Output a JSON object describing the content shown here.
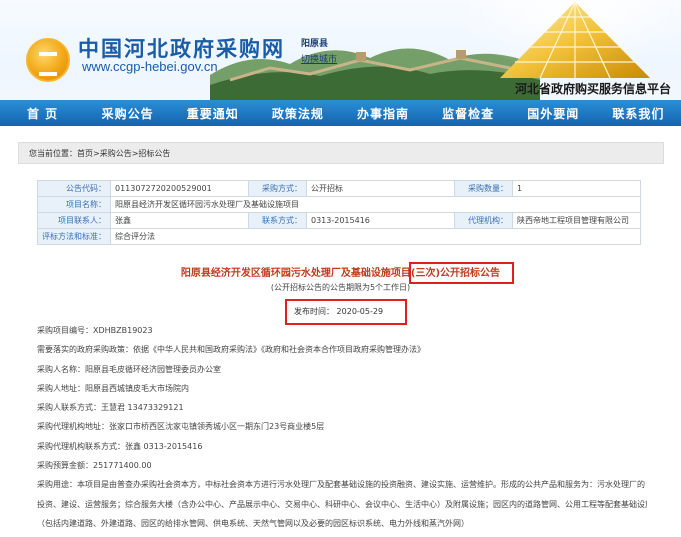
{
  "header": {
    "site_name": "中国河北政府采购网",
    "site_url": "www.ccgp-hebei.gov.cn",
    "city": "阳原县",
    "switch_city": "切换城市",
    "platform": "河北省政府购买服务信息平台"
  },
  "nav": [
    "首 页",
    "采购公告",
    "重要通知",
    "政策法规",
    "办事指南",
    "监督检查",
    "国外要闻",
    "联系我们"
  ],
  "breadcrumb": "您当前位置：首页>采购公告>招标公告",
  "info": {
    "row1": {
      "k1": "公告代码：",
      "v1": "0113072720200529001",
      "k2": "采购方式：",
      "v2": "公开招标",
      "k3": "采购数量：",
      "v3": "1"
    },
    "row2": {
      "k1": "项目名称：",
      "v1": "阳原县经济开发区循环园污水处理厂及基础设施项目"
    },
    "row3": {
      "k1": "项目联系人：",
      "v1": "张鑫",
      "k2": "联系方式：",
      "v2": "0313-2015416",
      "k3": "代理机构：",
      "v3": "陕西帝地工程项目管理有限公司"
    },
    "row4": {
      "k1": "评标方法和标准：",
      "v1": "综合评分法"
    }
  },
  "notice": {
    "title": "阳原县经济开发区循环园污水处理厂及基础设施项目(三次)公开招标公告",
    "subtitle": "(公开招标公告的公告期限为5个工作日)",
    "publish_label": "发布时间：",
    "publish_date": "2020-05-29"
  },
  "body": {
    "lines": [
      "采购项目编号：XDHBZB19023",
      "需要落实的政府采购政策：依据《中华人民共和国政府采购法》《政府和社会资本合作项目政府采购管理办法》",
      "采购人名称：阳原县毛皮循环经济园管理委员办公室",
      "采购人地址：阳原县西城镇皮毛大市场院内",
      "采购人联系方式：王慧君 13473329121",
      "采购代理机构地址：张家口市桥西区沈家屯镇领秀城小区一期东门23号商业楼5层",
      "采购代理机构联系方式：张鑫 0313-2015416",
      "采购预算金额：251771400.00",
      "采购用途：本项目是由普查办采购社会资本方，中标社会资本方进行污水处理厂及配套基础设施的投资融资、建设实施、运营维护。形成的公共产品和服务为：污水处理厂的",
      "投资、建设、运营服务；综合服务大楼（含办公中心、产品展示中心、交易中心、科研中心、会议中心、生活中心）及附属设施；园区内的道路管网、公用工程等配套基础设施",
      "（包括内建道路、外建道路、园区的给排水管网、供电系统、天然气管网以及必要的园区标识系统、电力外线和蒸汽外网）"
    ]
  },
  "colors": {
    "brand_blue": "#1a5ca8",
    "nav_blue": "#1563b0",
    "title_red": "#c23a1e",
    "highlight_red": "#e02020"
  }
}
